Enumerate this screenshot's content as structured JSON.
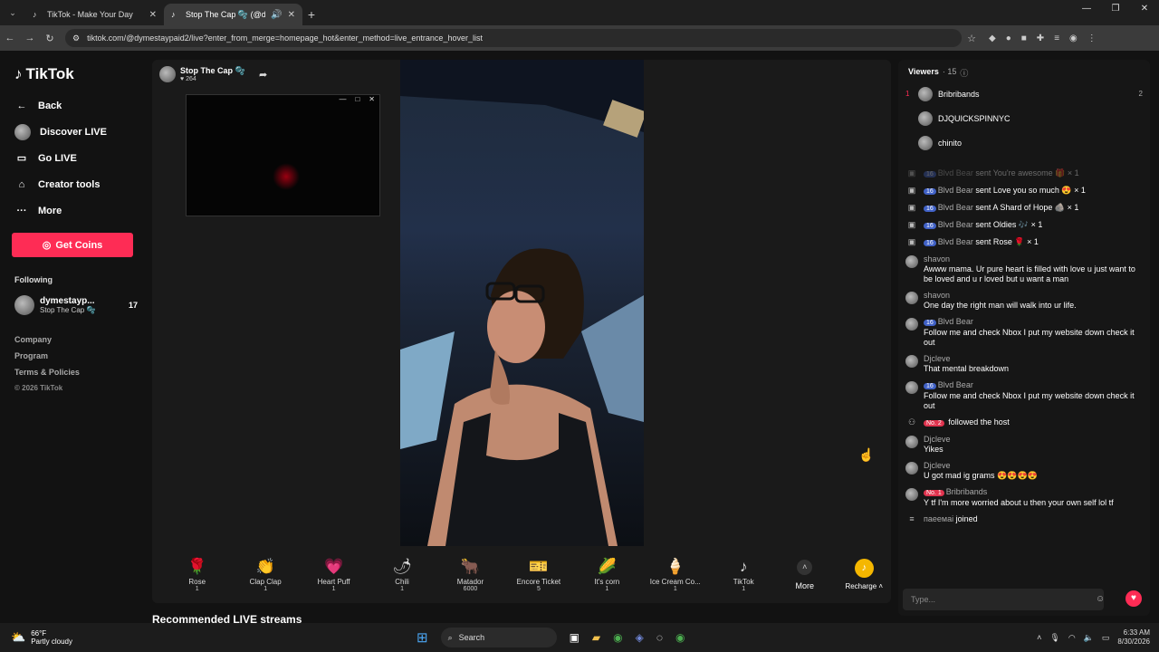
{
  "browser": {
    "tabs": [
      {
        "title": "TikTok - Make Your Day",
        "active": false
      },
      {
        "title": "Stop The Cap 🫧 (@dyme...",
        "active": true
      }
    ],
    "url": "tiktok.com/@dymestaypaid2/live?enter_from_merge=homepage_hot&enter_method=live_entrance_hover_list"
  },
  "sidebar": {
    "logo": "TikTok",
    "nav": [
      {
        "label": "Back",
        "icon": "back-arrow-icon"
      },
      {
        "label": "Discover LIVE",
        "icon": "live-avatar-icon"
      },
      {
        "label": "Go LIVE",
        "icon": "video-camera-icon"
      },
      {
        "label": "Creator tools",
        "icon": "house-icon"
      },
      {
        "label": "More",
        "icon": "ellipsis-icon"
      }
    ],
    "get_coins": "Get Coins",
    "following_label": "Following",
    "following": [
      {
        "name": "dymestayp...",
        "sub": "Stop The Cap 🫧",
        "count": "17"
      }
    ],
    "links": [
      "Company",
      "Program",
      "Terms & Policies"
    ],
    "copyright": "© 2026 TikTok"
  },
  "stream": {
    "host_name": "Stop The Cap 🫧",
    "likes": "♥ 264",
    "recommended": "Recommended LIVE streams"
  },
  "gifts": [
    {
      "name": "Rose",
      "price": "1",
      "icon": "🌹"
    },
    {
      "name": "Clap Clap",
      "price": "1",
      "icon": "👏"
    },
    {
      "name": "Heart Puff",
      "price": "1",
      "icon": "💗"
    },
    {
      "name": "Chili",
      "price": "1",
      "icon": "🌶"
    },
    {
      "name": "Matador",
      "price": "6000",
      "icon": "🐂"
    },
    {
      "name": "Encore Ticket",
      "price": "5",
      "icon": "🎫"
    },
    {
      "name": "It's corn",
      "price": "1",
      "icon": "🌽"
    },
    {
      "name": "Ice Cream Co...",
      "price": "1",
      "icon": "🍦"
    },
    {
      "name": "TikTok",
      "price": "1",
      "icon": "♪"
    }
  ],
  "gift_more": "More",
  "recharge": "Recharge ˄",
  "viewers": {
    "label": "Viewers",
    "count": "· 15",
    "list": [
      {
        "rank": "1",
        "name": "Bribribands",
        "count": "2"
      },
      {
        "rank": "",
        "name": "DJQUICKSPINNYC",
        "count": ""
      },
      {
        "rank": "",
        "name": "chinito",
        "count": ""
      }
    ]
  },
  "chat": [
    {
      "kind": "gift",
      "badge": "16",
      "user": "Blvd Bear",
      "text": "sent You're awesome 🎁 × 1",
      "faded": true
    },
    {
      "kind": "gift",
      "badge": "16",
      "user": "Blvd Bear",
      "text": "sent Love you so much 😍 × 1"
    },
    {
      "kind": "gift",
      "badge": "16",
      "user": "Blvd Bear",
      "text": "sent A Shard of Hope 🪨 × 1"
    },
    {
      "kind": "gift",
      "badge": "16",
      "user": "Blvd Bear",
      "text": "sent Oldies 🎶 × 1"
    },
    {
      "kind": "gift",
      "badge": "16",
      "user": "Blvd Bear",
      "text": "sent Rose 🌹 × 1"
    },
    {
      "kind": "msg",
      "badge": "",
      "user": "shavon",
      "text": "Awww mama. Ur pure heart is filled with love u just want to be loved and u r loved but u want a man"
    },
    {
      "kind": "msg",
      "badge": "",
      "user": "shavon",
      "text": "One day the right man will walk into ur life."
    },
    {
      "kind": "msg",
      "badge": "16",
      "user": "Blvd Bear",
      "text": "Follow me and check Nbox I put my website down check it out"
    },
    {
      "kind": "msg",
      "badge": "",
      "user": "Djcleve",
      "text": "That mental breakdown"
    },
    {
      "kind": "msg",
      "badge": "16",
      "user": "Blvd Bear",
      "text": "Follow me and check Nbox I put my website down check it out"
    },
    {
      "kind": "follow",
      "badge": "No. 2",
      "user": "",
      "text": "followed the host"
    },
    {
      "kind": "msg",
      "badge": "",
      "user": "Djcleve",
      "text": "Yikes"
    },
    {
      "kind": "msg",
      "badge": "",
      "user": "Djcleve",
      "text": "U got mad ig grams 😍😍😍😍"
    },
    {
      "kind": "msg",
      "badge": "No. 1",
      "user": "Bribribands",
      "text": "Y tf I'm more worried about u then your own self lol tf"
    },
    {
      "kind": "join",
      "badge": "",
      "user": "паеемаі",
      "text": "joined"
    }
  ],
  "chat_placeholder": "Type...",
  "taskbar": {
    "temp": "66°F",
    "condition": "Partly cloudy",
    "search": "Search",
    "time": "6:33 AM",
    "date": "8/30/2026"
  }
}
